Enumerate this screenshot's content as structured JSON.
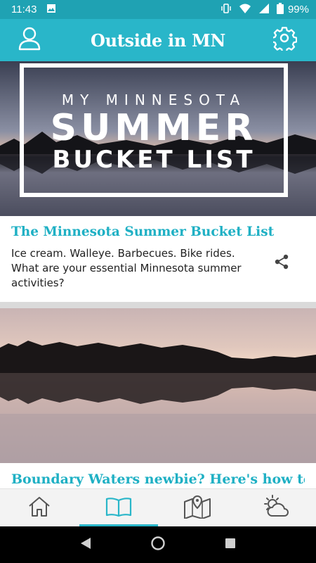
{
  "status_bar": {
    "time": "11:43",
    "battery": "99%",
    "icons": [
      "image-icon",
      "vibrate-icon",
      "wifi-icon",
      "signal-icon",
      "battery-icon"
    ]
  },
  "app_bar": {
    "title": "Outside in MN",
    "left_icon": "profile-icon",
    "right_icon": "gear-icon",
    "color": "#29b6c9"
  },
  "feed": {
    "cards": [
      {
        "image_text": {
          "line1": "MY MINNESOTA",
          "line2": "SUMMER",
          "line3": "BUCKET LIST"
        },
        "title": "The Minnesota Summer Bucket List",
        "description": "Ice cream. Walleye. Barbecues. Bike rides. What are your essential Minnesota summer activities?",
        "share_icon": "share-icon"
      },
      {
        "title": "Boundary Waters newbie? Here's how to"
      }
    ]
  },
  "bottom_nav": {
    "items": [
      {
        "icon": "home-icon",
        "active": false
      },
      {
        "icon": "book-icon",
        "active": true
      },
      {
        "icon": "map-icon",
        "active": false
      },
      {
        "icon": "weather-icon",
        "active": false
      }
    ],
    "accent": "#29b6c9"
  },
  "system_nav": {
    "icons": [
      "back-icon",
      "home-circle-icon",
      "recents-icon"
    ]
  },
  "colors": {
    "title_teal": "#1fb0c4",
    "separator": "#dadada"
  }
}
